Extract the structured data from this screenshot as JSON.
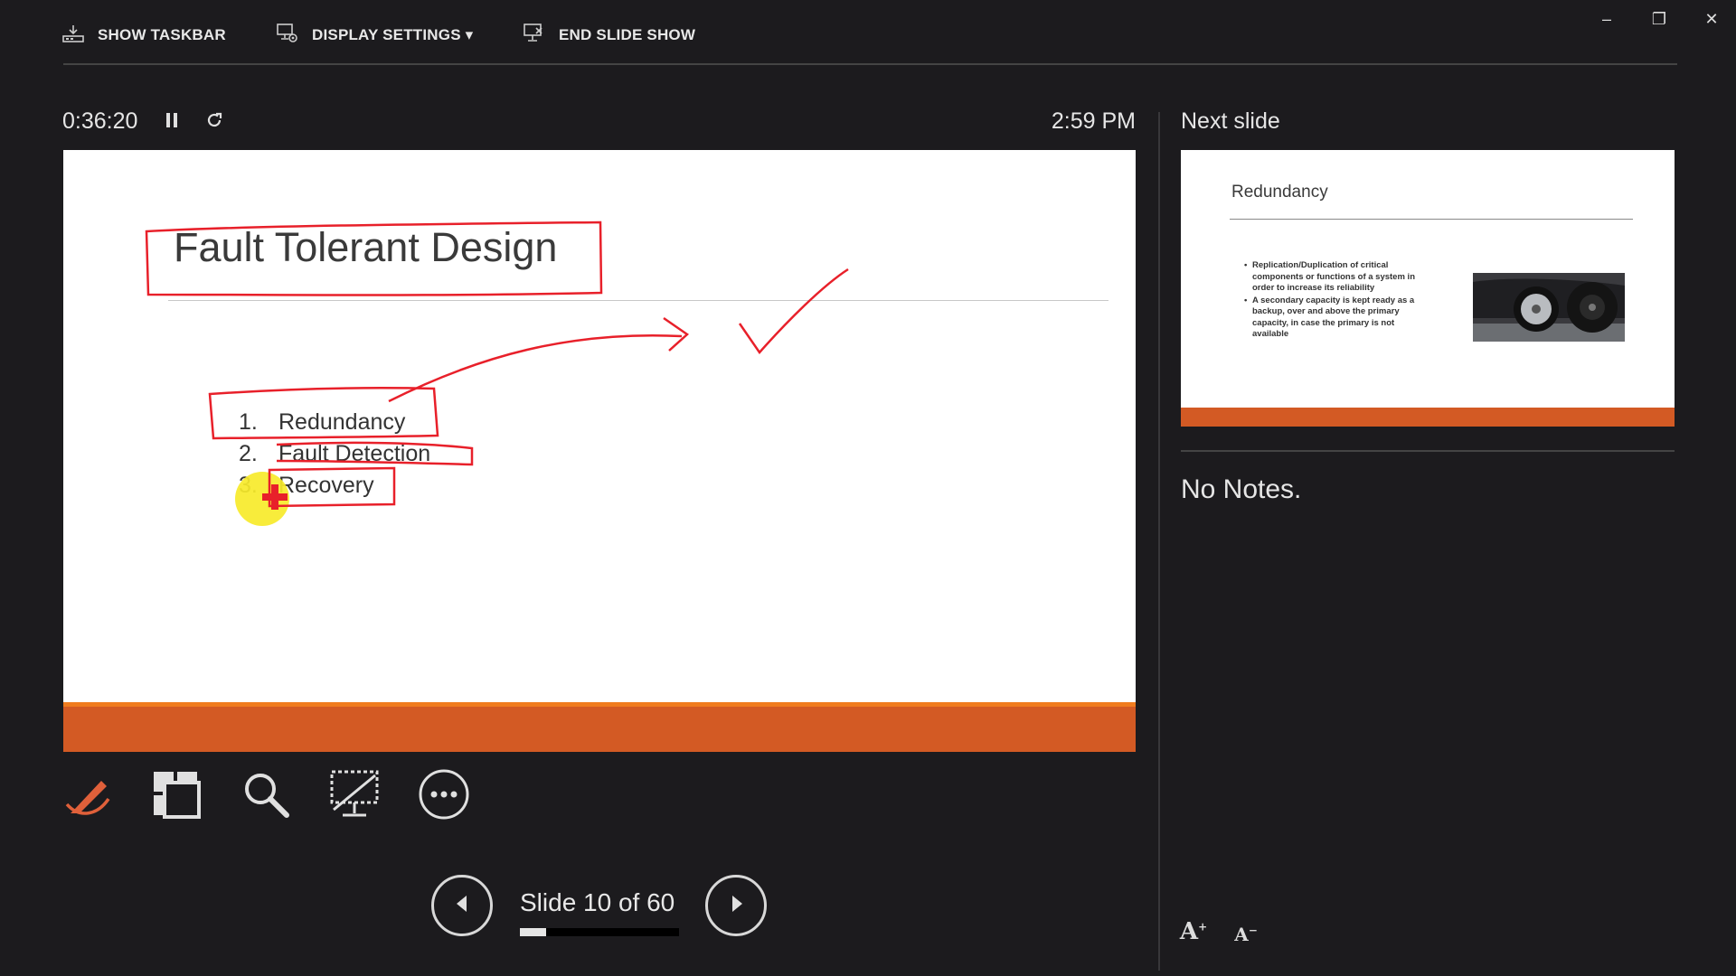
{
  "toolbar": {
    "show_taskbar": "SHOW TASKBAR",
    "display_settings": "DISPLAY SETTINGS ▾",
    "end_slide_show": "END SLIDE SHOW"
  },
  "window_controls": {
    "minimize": "–",
    "restore": "❐",
    "close": "✕"
  },
  "presenter": {
    "elapsed_time": "0:36:20",
    "clock": "2:59 PM",
    "slide_counter": "Slide 10 of 60",
    "slide_index": 10,
    "slide_total": 60,
    "progress_fraction": 0.1667
  },
  "current_slide": {
    "title": "Fault Tolerant Design",
    "items": [
      {
        "num": "1.",
        "text": "Redundancy"
      },
      {
        "num": "2.",
        "text": "Fault Detection"
      },
      {
        "num": "3.",
        "text": "Recovery"
      }
    ],
    "accent_color": "#d35a24",
    "ink_color": "#e8202a"
  },
  "next_slide": {
    "label": "Next slide",
    "title": "Redundancy",
    "bullets": [
      "Replication/Duplication of critical components or functions of a system in order to increase its reliability",
      "A secondary capacity is kept ready as a backup, over and above the primary capacity, in case the primary is not available"
    ]
  },
  "notes": {
    "text": "No Notes."
  },
  "icons": {
    "show_taskbar": "taskbar-icon",
    "display_settings": "display-settings-icon",
    "end_show": "end-show-icon",
    "pause": "pause-icon",
    "reset": "reset-timer-icon",
    "pen": "pen-laser-icon",
    "see_all": "see-all-slides-icon",
    "zoom": "zoom-magnifier-icon",
    "black_screen": "black-screen-icon",
    "more": "more-options-icon",
    "prev": "previous-slide-icon",
    "next": "next-slide-icon",
    "font_larger": "font-increase-icon",
    "font_smaller": "font-decrease-icon"
  }
}
